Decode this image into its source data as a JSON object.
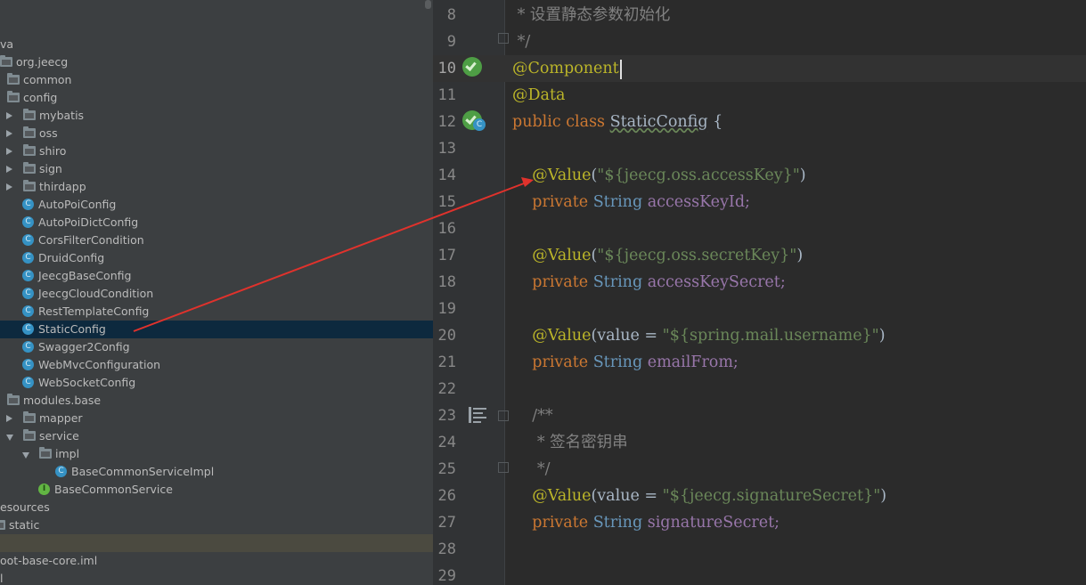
{
  "tree": {
    "items": [
      {
        "label": "va",
        "kind": "text"
      },
      {
        "label": "org.jeecg",
        "kind": "folder"
      },
      {
        "label": "common",
        "kind": "folder"
      },
      {
        "label": "config",
        "kind": "folder"
      },
      {
        "label": "mybatis",
        "kind": "folder",
        "expander": "collapsed"
      },
      {
        "label": "oss",
        "kind": "folder",
        "expander": "collapsed"
      },
      {
        "label": "shiro",
        "kind": "folder",
        "expander": "collapsed"
      },
      {
        "label": "sign",
        "kind": "folder",
        "expander": "collapsed"
      },
      {
        "label": "thirdapp",
        "kind": "folder",
        "expander": "collapsed"
      },
      {
        "label": "AutoPoiConfig",
        "kind": "class",
        "icon": "C"
      },
      {
        "label": "AutoPoiDictConfig",
        "kind": "class",
        "icon": "C"
      },
      {
        "label": "CorsFilterCondition",
        "kind": "class",
        "icon": "C"
      },
      {
        "label": "DruidConfig",
        "kind": "class",
        "icon": "C"
      },
      {
        "label": "JeecgBaseConfig",
        "kind": "class",
        "icon": "C"
      },
      {
        "label": "JeecgCloudCondition",
        "kind": "class",
        "icon": "C"
      },
      {
        "label": "RestTemplateConfig",
        "kind": "class",
        "icon": "C"
      },
      {
        "label": "StaticConfig",
        "kind": "class",
        "icon": "C",
        "selected": true
      },
      {
        "label": "Swagger2Config",
        "kind": "class",
        "icon": "C"
      },
      {
        "label": "WebMvcConfiguration",
        "kind": "class",
        "icon": "C"
      },
      {
        "label": "WebSocketConfig",
        "kind": "class",
        "icon": "C"
      },
      {
        "label": "modules.base",
        "kind": "folder"
      },
      {
        "label": "mapper",
        "kind": "folder",
        "expander": "collapsed"
      },
      {
        "label": "service",
        "kind": "folder",
        "expander": "expanded"
      },
      {
        "label": "impl",
        "kind": "folder",
        "expander": "expanded"
      },
      {
        "label": "BaseCommonServiceImpl",
        "kind": "class",
        "icon": "C"
      },
      {
        "label": "BaseCommonService",
        "kind": "interface",
        "icon": "I"
      },
      {
        "label": "esources",
        "kind": "text"
      },
      {
        "label": "static",
        "kind": "folder"
      },
      {
        "label": "",
        "kind": "text",
        "hover": true
      },
      {
        "label": "oot-base-core.iml",
        "kind": "text"
      },
      {
        "label": "l",
        "kind": "text"
      }
    ]
  },
  "editor": {
    "lines": [
      {
        "num": "8",
        "segments": [
          {
            "t": " * 设置静态参数初始化",
            "c": "cmt"
          }
        ]
      },
      {
        "num": "9",
        "segments": [
          {
            "t": " */",
            "c": "cmt"
          }
        ]
      },
      {
        "num": "10",
        "segments": [
          {
            "t": "@Component",
            "c": "ann"
          }
        ],
        "caret": true
      },
      {
        "num": "11",
        "segments": [
          {
            "t": "@Data",
            "c": "ann"
          }
        ]
      },
      {
        "num": "12",
        "segments": [
          {
            "t": "public class ",
            "c": "kw"
          },
          {
            "t": "StaticConfig",
            "c": "cls-ref"
          },
          {
            "t": " {",
            "c": ""
          }
        ]
      },
      {
        "num": "13",
        "segments": []
      },
      {
        "num": "14",
        "segments": [
          {
            "t": "    ",
            "c": ""
          },
          {
            "t": "@Value",
            "c": "ann"
          },
          {
            "t": "(",
            "c": ""
          },
          {
            "t": "\"${jeecg.oss.accessKey}\"",
            "c": "str"
          },
          {
            "t": ")",
            "c": ""
          }
        ]
      },
      {
        "num": "15",
        "segments": [
          {
            "t": "    private ",
            "c": "kw"
          },
          {
            "t": "String",
            "c": "type"
          },
          {
            "t": " accessKeyId;",
            "c": "fld"
          }
        ]
      },
      {
        "num": "16",
        "segments": []
      },
      {
        "num": "17",
        "segments": [
          {
            "t": "    ",
            "c": ""
          },
          {
            "t": "@Value",
            "c": "ann"
          },
          {
            "t": "(",
            "c": ""
          },
          {
            "t": "\"${jeecg.oss.secretKey}\"",
            "c": "str"
          },
          {
            "t": ")",
            "c": ""
          }
        ]
      },
      {
        "num": "18",
        "segments": [
          {
            "t": "    private ",
            "c": "kw"
          },
          {
            "t": "String",
            "c": "type"
          },
          {
            "t": " accessKeySecret;",
            "c": "fld"
          }
        ]
      },
      {
        "num": "19",
        "segments": []
      },
      {
        "num": "20",
        "segments": [
          {
            "t": "    ",
            "c": ""
          },
          {
            "t": "@Value",
            "c": "ann"
          },
          {
            "t": "(value = ",
            "c": ""
          },
          {
            "t": "\"${spring.mail.username}\"",
            "c": "str"
          },
          {
            "t": ")",
            "c": ""
          }
        ]
      },
      {
        "num": "21",
        "segments": [
          {
            "t": "    private ",
            "c": "kw"
          },
          {
            "t": "String",
            "c": "type"
          },
          {
            "t": " emailFrom;",
            "c": "fld"
          }
        ]
      },
      {
        "num": "22",
        "segments": []
      },
      {
        "num": "23",
        "segments": [
          {
            "t": "    /**",
            "c": "cmt"
          }
        ]
      },
      {
        "num": "24",
        "segments": [
          {
            "t": "     * 签名密钥串",
            "c": "cmt"
          }
        ]
      },
      {
        "num": "25",
        "segments": [
          {
            "t": "     */",
            "c": "cmt"
          }
        ]
      },
      {
        "num": "26",
        "segments": [
          {
            "t": "    ",
            "c": ""
          },
          {
            "t": "@Value",
            "c": "ann"
          },
          {
            "t": "(value = ",
            "c": ""
          },
          {
            "t": "\"${jeecg.signatureSecret}\"",
            "c": "str"
          },
          {
            "t": ")",
            "c": ""
          }
        ]
      },
      {
        "num": "27",
        "segments": [
          {
            "t": "    private ",
            "c": "kw"
          },
          {
            "t": "String",
            "c": "type"
          },
          {
            "t": " signatureSecret;",
            "c": "fld"
          }
        ]
      },
      {
        "num": "28",
        "segments": []
      },
      {
        "num": "29",
        "segments": []
      }
    ]
  },
  "gutter_icons": {
    "line10": "spring-bean-icon",
    "line12": "spring-class-icon",
    "line12_badge": "C",
    "line23": "javadoc-icon"
  },
  "annotation_arrow": {
    "color": "#e0322c"
  },
  "colors": {
    "tree_bg": "#3c3f41",
    "editor_bg": "#2b2b2b",
    "selection": "#0d293e",
    "keyword": "#cc7832",
    "annotation": "#bbb529",
    "string": "#6a8759",
    "field": "#9876aa",
    "comment": "#808080"
  }
}
